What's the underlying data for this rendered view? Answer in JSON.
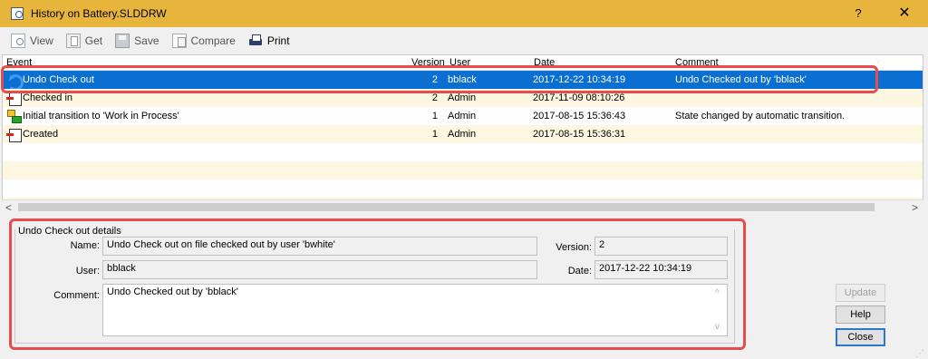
{
  "window": {
    "title": "History on Battery.SLDDRW",
    "help_label": "?",
    "close_label": "✕"
  },
  "toolbar": {
    "view_label": "View",
    "get_label": "Get",
    "save_label": "Save",
    "compare_label": "Compare",
    "print_label": "Print"
  },
  "list": {
    "columns": [
      "Event",
      "Version",
      "User",
      "Date",
      "Comment"
    ],
    "rows": [
      {
        "event": "Undo Check out",
        "icon": "undo-icon",
        "version": "2",
        "user": "bblack",
        "date": "2017-12-22 10:34:19",
        "comment": "Undo Checked out by 'bblack'"
      },
      {
        "event": "Checked in",
        "icon": "check-in-icon",
        "version": "2",
        "user": "Admin",
        "date": "2017-11-09 08:10:26",
        "comment": ""
      },
      {
        "event": "Initial transition to 'Work in Process'",
        "icon": "workflow-transition-icon",
        "version": "1",
        "user": "Admin",
        "date": "2017-08-15 15:36:43",
        "comment": "State changed by automatic transition."
      },
      {
        "event": "Created",
        "icon": "created-icon",
        "version": "1",
        "user": "Admin",
        "date": "2017-08-15 15:36:31",
        "comment": ""
      }
    ],
    "scroll_left": "<",
    "scroll_right": ">"
  },
  "details": {
    "title": "Undo Check out details",
    "name_label": "Name:",
    "name_value": "Undo Check out on file checked out by user 'bwhite'",
    "user_label": "User:",
    "user_value": "bblack",
    "comment_label": "Comment:",
    "comment_value": "Undo Checked out by 'bblack'",
    "version_label": "Version:",
    "version_value": "2",
    "date_label": "Date:",
    "date_value": "2017-12-22 10:34:19",
    "scroll_up": "^",
    "scroll_down": "v"
  },
  "buttons": {
    "update_label": "Update",
    "help_label": "Help",
    "close_label": "Close"
  },
  "colors": {
    "titlebar": "#e8b53c",
    "selected_row": "#0b6fd1",
    "alt_row": "#fdf7e1",
    "annotation": "#e84b4b"
  }
}
